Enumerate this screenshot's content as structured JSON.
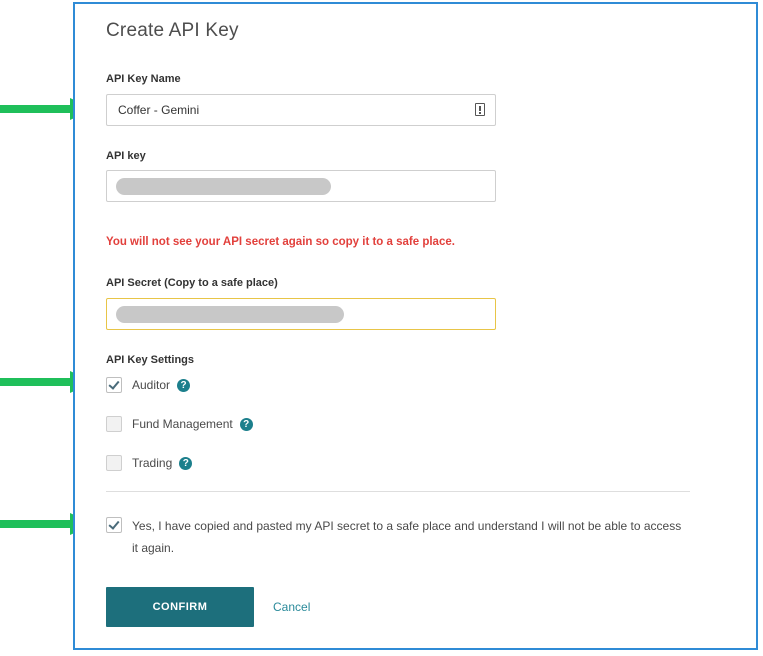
{
  "title": "Create API Key",
  "api_key_name": {
    "label": "API Key Name",
    "value": "Coffer - Gemini",
    "icon": "info-badge-icon"
  },
  "api_key": {
    "label": "API key",
    "redacted": true
  },
  "warning": "You will not see your API secret again so copy it to a safe place.",
  "api_secret": {
    "label": "API Secret (Copy to a safe place)",
    "redacted": true
  },
  "settings": {
    "label": "API Key Settings",
    "options": [
      {
        "label": "Auditor",
        "checked": true,
        "help_icon": "question-circle-icon"
      },
      {
        "label": "Fund Management",
        "checked": false,
        "help_icon": "question-circle-icon"
      },
      {
        "label": "Trading",
        "checked": false,
        "help_icon": "question-circle-icon"
      }
    ]
  },
  "acknowledgement": {
    "checked": true,
    "text": "Yes, I have copied and pasted my API secret to a safe place and understand I will not be able to access it again."
  },
  "actions": {
    "confirm_label": "CONFIRM",
    "cancel_label": "Cancel"
  },
  "colors": {
    "frame_border": "#2f8bd6",
    "arrow": "#1fbf5a",
    "warning": "#e2403c",
    "confirm_button": "#1d6f7c",
    "help_icon": "#1c7f8c",
    "secret_focus_border": "#e8c547"
  },
  "annotations": {
    "arrow_icon": "green-arrow-right-icon"
  }
}
